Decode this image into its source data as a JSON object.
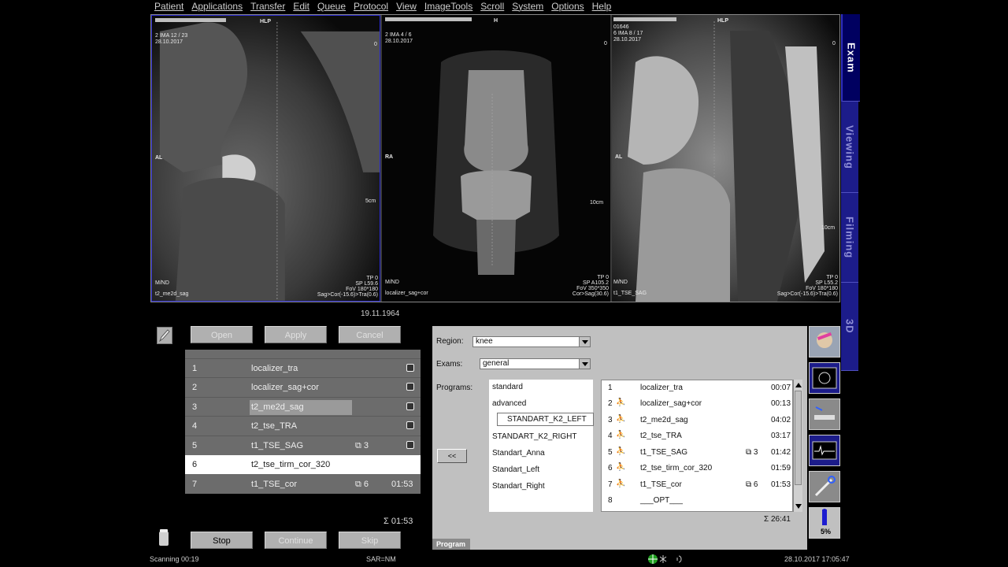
{
  "menu": [
    "Patient",
    "Applications",
    "Transfer",
    "Edit",
    "Queue",
    "Protocol",
    "View",
    "ImageTools",
    "Scroll",
    "System",
    "Options",
    "Help"
  ],
  "viewports": [
    {
      "top_label": "HLP",
      "info_tl": "2 IMA 12 / 23\n28.10.2017",
      "side_label": "AL",
      "bl1": "M/ND",
      "bl2": "t2_me2d_sag",
      "br1": "TP 0",
      "br2": "SP L59.6",
      "br3": "FoV 180*180",
      "br4": "Sag>Cor(-15.6)>Tra(0.6)",
      "tr_num": "0",
      "scale": "5cm"
    },
    {
      "top_label": "H",
      "info_tl": "2 IMA 4 / 6\n28.10.2017",
      "side_label": "RA",
      "bl1": "M/ND",
      "bl2": "localizer_sag+cor",
      "br1": "TP 0",
      "br2": "SP A105.2",
      "br3": "FoV 350*350",
      "br4": "Cor>Sag(30.6)",
      "tr_num": "0",
      "scale": "10cm"
    },
    {
      "top_label": "HLP",
      "info_tl": "01646\n6 IMA 8 / 17\n28.10.2017",
      "side_label": "AL",
      "bl1": "M/ND",
      "bl2": "t1_TSE_SAG",
      "br1": "TP 0",
      "br2": "SP L55.2",
      "br3": "FoV 180*180",
      "br4": "Sag>Cor(-15.6)>Tra(0.6)",
      "tr_num": "0",
      "scale": "10cm"
    }
  ],
  "vtabs": [
    "Exam",
    "Viewing",
    "Filming",
    "3D"
  ],
  "date_label": "19.11.1964",
  "buttons": {
    "open": "Open",
    "apply": "Apply",
    "cancel": "Cancel",
    "stop": "Stop",
    "continue": "Continue",
    "skip": "Skip"
  },
  "queue": [
    {
      "num": "1",
      "name": "localizer_tra",
      "count": "",
      "time": ""
    },
    {
      "num": "2",
      "name": "localizer_sag+cor",
      "count": "",
      "time": ""
    },
    {
      "num": "3",
      "name": "t2_me2d_sag",
      "count": "",
      "time": ""
    },
    {
      "num": "4",
      "name": "t2_tse_TRA",
      "count": "",
      "time": ""
    },
    {
      "num": "5",
      "name": "t1_TSE_SAG",
      "count": "3",
      "time": ""
    },
    {
      "num": "6",
      "name": "t2_tse_tirm_cor_320",
      "count": "",
      "time": ""
    },
    {
      "num": "7",
      "name": "t1_TSE_cor",
      "count": "6",
      "time": "01:53"
    }
  ],
  "queue_sum": "Σ 01:53",
  "program": {
    "region_label": "Region:",
    "region_value": "knee",
    "exams_label": "Exams:",
    "exams_value": "general",
    "programs_label": "Programs:",
    "programs": [
      "standard",
      "advanced",
      "STANDART_K2_LEFT",
      "STANDART_K2_RIGHT",
      "Standart_Anna",
      "Standart_Left",
      "Standart_Right"
    ],
    "back_label": "<<",
    "sequences": [
      {
        "n": "1",
        "name": "localizer_tra",
        "count": "",
        "time": "00:07"
      },
      {
        "n": "2",
        "name": "localizer_sag+cor",
        "count": "",
        "time": "00:13"
      },
      {
        "n": "3",
        "name": "t2_me2d_sag",
        "count": "",
        "time": "04:02"
      },
      {
        "n": "4",
        "name": "t2_tse_TRA",
        "count": "",
        "time": "03:17"
      },
      {
        "n": "5",
        "name": "t1_TSE_SAG",
        "count": "3",
        "time": "01:42"
      },
      {
        "n": "6",
        "name": "t2_tse_tirm_cor_320",
        "count": "",
        "time": "01:59"
      },
      {
        "n": "7",
        "name": "t1_TSE_cor",
        "count": "6",
        "time": "01:53"
      },
      {
        "n": "8",
        "name": "___OPT___",
        "count": "",
        "time": ""
      }
    ],
    "sum": "Σ 26:41",
    "tab_label": "Program"
  },
  "tool_percent": "5%",
  "status": {
    "scanning": "Scanning 00:19",
    "sar": "SAR=NM",
    "datetime": "28.10.2017 17:05:47"
  }
}
